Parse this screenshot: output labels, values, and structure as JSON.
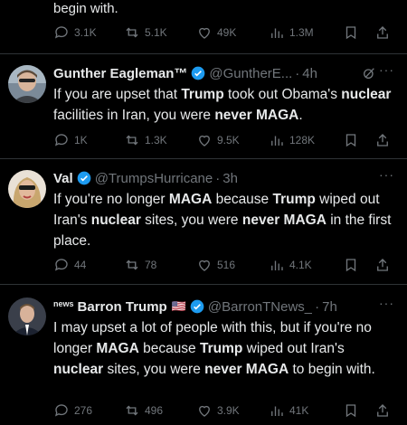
{
  "prev_tweet": {
    "text_tail": "begin with.",
    "actions": {
      "replies": "3.1K",
      "reposts": "5.1K",
      "likes": "49K",
      "views": "1.3M"
    }
  },
  "tweets": [
    {
      "name": "Gunther Eagleman™",
      "handle": "@GuntherE...",
      "time": "4h",
      "body": [
        "If you are upset that ",
        {
          "b": "Trump"
        },
        " took out Obama's ",
        {
          "b": "nuclear"
        },
        " facilities in Iran, you were ",
        {
          "b": "never MAGA"
        },
        "."
      ],
      "actions": {
        "replies": "1K",
        "reposts": "1.3K",
        "likes": "9.5K",
        "views": "128K"
      }
    },
    {
      "name": "Val",
      "handle": "@TrumpsHurricane",
      "time": "3h",
      "body": [
        "If you're no longer ",
        {
          "b": "MAGA"
        },
        " because ",
        {
          "b": "Trump"
        },
        " wiped out Iran's ",
        {
          "b": "nuclear"
        },
        " sites, you were ",
        {
          "b": "never MAGA"
        },
        " in the first place."
      ],
      "actions": {
        "replies": "44",
        "reposts": "78",
        "likes": "516",
        "views": "4.1K"
      }
    },
    {
      "name_prefix": "news",
      "name": "Barron Trump",
      "flag": "🇺🇸",
      "handle": "@BarronTNews_",
      "time": "7h",
      "body": [
        "I may upset a lot of people with this, but if you're no longer ",
        {
          "b": "MAGA"
        },
        " because ",
        {
          "b": "Trump"
        },
        " wiped out Iran's ",
        {
          "b": "nuclear"
        },
        " sites, you were ",
        {
          "b": "never MAGA"
        },
        " to begin with."
      ],
      "actions": {
        "replies": "276",
        "reposts": "496",
        "likes": "3.9K",
        "views": "41K"
      }
    }
  ],
  "ui": {
    "separator": "·",
    "more": "···",
    "colors": {
      "background": "#000000",
      "text": "#e7e9ea",
      "muted": "#71767b",
      "verified": "#1d9bf0",
      "divider": "#2f3336"
    },
    "icons": [
      "reply-icon",
      "repost-icon",
      "like-icon",
      "views-icon",
      "bookmark-icon",
      "share-icon",
      "verified-badge-icon",
      "grok-icon",
      "more-icon"
    ]
  }
}
